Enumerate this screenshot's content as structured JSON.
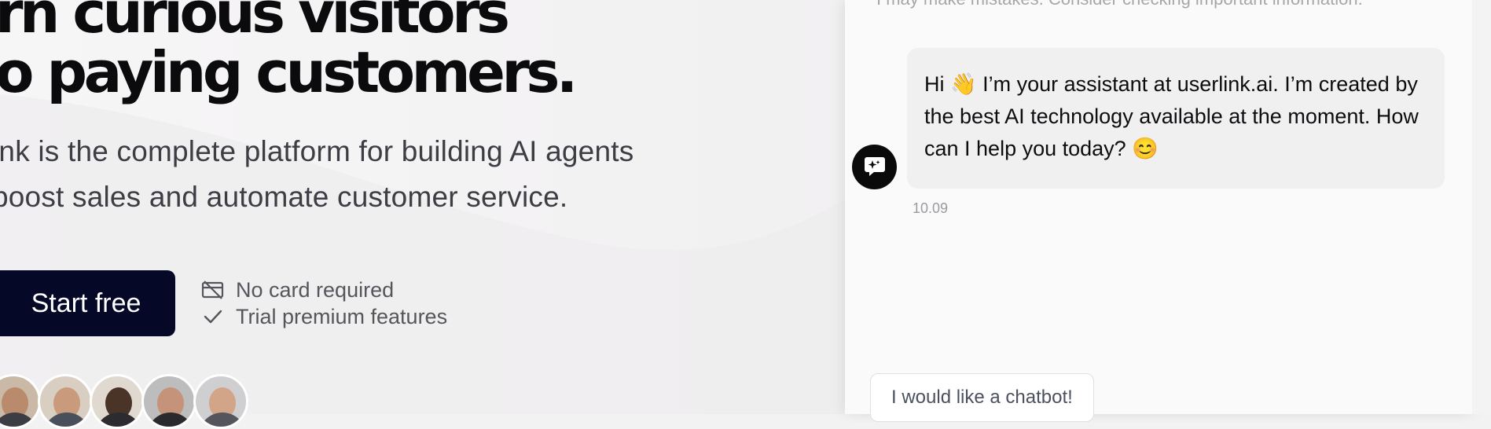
{
  "hero": {
    "title_line1": "rn curious visitors",
    "title_line2": "o paying customers.",
    "subtitle_line1": "ink is the complete platform for building AI agents",
    "subtitle_line2": "boost sales and automate customer service.",
    "cta_label": "Start free",
    "perks": [
      {
        "icon": "no-card-icon",
        "label": "No card required"
      },
      {
        "icon": "check-icon",
        "label": "Trial premium features"
      }
    ],
    "avatar_count": 5
  },
  "chat": {
    "disclaimer": "I may make mistakes. Consider checking important information.",
    "bot_icon": "chat-sparkle-icon",
    "message": "Hi 👋 I’m your assistant at userlink.ai. I’m created by the best AI technology available at the moment. How can I help you today? 😊",
    "time": "10.09",
    "suggestion": "I would like a chatbot!"
  },
  "colors": {
    "cta_bg": "#060827",
    "title": "#0b0b0e",
    "panel_bg": "#fafafa",
    "bubble_bg": "#f0f0f1"
  }
}
